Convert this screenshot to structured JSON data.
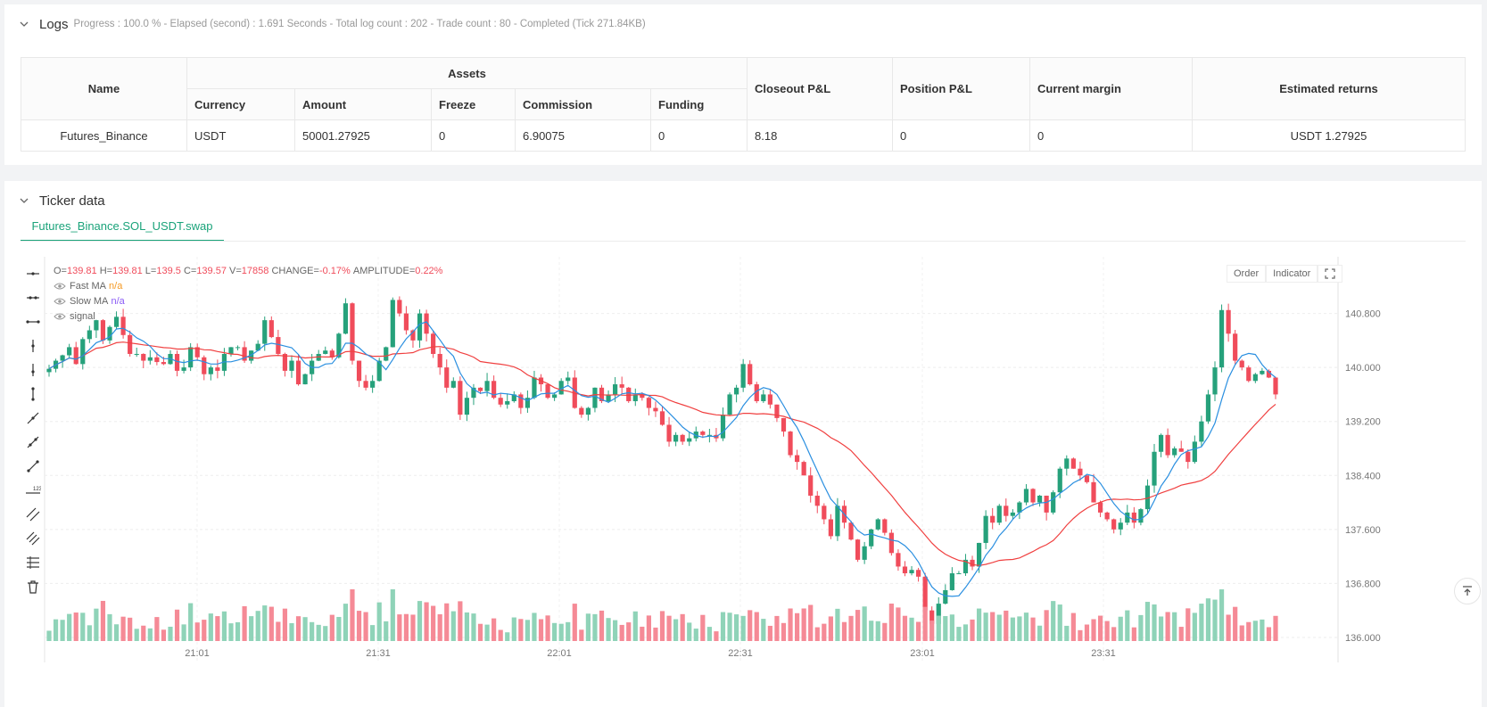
{
  "logs": {
    "title": "Logs",
    "status": "Progress : 100.0 % - Elapsed (second) : 1.691  Seconds - Total log count : 202 - Trade count : 80 - Completed (Tick 271.84KB)"
  },
  "assets_table": {
    "headers": {
      "name": "Name",
      "assets": "Assets",
      "currency": "Currency",
      "amount": "Amount",
      "freeze": "Freeze",
      "commission": "Commission",
      "funding": "Funding",
      "closeout": "Closeout P&L",
      "position": "Position P&L",
      "margin": "Current margin",
      "returns": "Estimated returns"
    },
    "row": {
      "name": "Futures_Binance",
      "currency": "USDT",
      "amount": "50001.27925",
      "freeze": "0",
      "commission": "6.90075",
      "funding": "0",
      "closeout": "8.18",
      "position": "0",
      "margin": "0",
      "returns": "USDT 1.27925"
    }
  },
  "ticker": {
    "title": "Ticker data",
    "tab": "Futures_Binance.SOL_USDT.swap"
  },
  "legend": {
    "ohlc": {
      "o_label": "O=",
      "o": "139.81",
      "h_label": "H=",
      "h": "139.81",
      "l_label": "L=",
      "l": "139.5",
      "c_label": "C=",
      "c": "139.57",
      "v_label": "V=",
      "v": "17858",
      "change_label": "CHANGE=",
      "change": "-0.17%",
      "amp_label": "AMPLITUDE=",
      "amp": "0.22%"
    },
    "fast_ma": {
      "label": "Fast MA",
      "value": "n/a"
    },
    "slow_ma": {
      "label": "Slow MA",
      "value": "n/a"
    },
    "signal": {
      "label": "signal"
    }
  },
  "chart_buttons": {
    "order": "Order",
    "indicator": "Indicator"
  },
  "colors": {
    "up": "#26a17b",
    "down": "#f04c5b",
    "fast_ma": "#2a8fe0",
    "slow_ma": "#f04040",
    "accent": "#1aa37a"
  },
  "chart_data": {
    "type": "candlestick",
    "y_ticks": [
      "140.800",
      "140.000",
      "139.200",
      "138.400",
      "137.600",
      "136.800",
      "136.000"
    ],
    "x_ticks": [
      "21:01",
      "21:31",
      "22:01",
      "22:31",
      "23:01",
      "23:31"
    ],
    "ylim": [
      135.92,
      141.6
    ],
    "close_path": [
      139.98,
      140.1,
      140.18,
      140.3,
      140.05,
      140.42,
      140.55,
      140.7,
      140.4,
      140.6,
      140.75,
      140.48,
      140.2,
      140.2,
      140.1,
      140.15,
      140.08,
      140.05,
      140.2,
      139.95,
      140.0,
      140.3,
      140.15,
      139.9,
      140.0,
      139.95,
      140.2,
      140.3,
      140.3,
      140.1,
      140.25,
      140.35,
      140.7,
      140.45,
      140.2,
      139.95,
      140.1,
      139.75,
      139.9,
      140.1,
      140.2,
      140.25,
      140.15,
      140.5,
      140.95,
      140.1,
      139.8,
      139.7,
      139.8,
      140.1,
      140.3,
      141.0,
      140.8,
      140.55,
      140.4,
      140.8,
      140.5,
      140.2,
      140.0,
      139.7,
      139.8,
      139.3,
      139.55,
      139.7,
      139.65,
      139.8,
      139.55,
      139.45,
      139.5,
      139.6,
      139.4,
      139.55,
      139.85,
      139.75,
      139.55,
      139.6,
      139.8,
      139.85,
      139.4,
      139.3,
      139.4,
      139.7,
      139.5,
      139.6,
      139.75,
      139.7,
      139.5,
      139.6,
      139.55,
      139.4,
      139.35,
      139.15,
      138.9,
      139.0,
      138.9,
      138.95,
      139.05,
      139.0,
      139.0,
      138.95,
      139.3,
      139.6,
      139.7,
      140.05,
      139.75,
      139.5,
      139.6,
      139.45,
      139.25,
      139.05,
      138.7,
      138.6,
      138.4,
      138.1,
      137.95,
      137.75,
      137.5,
      137.95,
      137.7,
      137.45,
      137.15,
      137.35,
      137.6,
      137.75,
      137.55,
      137.25,
      137.05,
      136.95,
      137.0,
      136.9,
      136.4,
      136.2,
      136.5,
      136.7,
      136.95,
      136.95,
      137.15,
      137.05,
      137.4,
      137.8,
      137.7,
      137.95,
      137.8,
      137.85,
      138.0,
      138.2,
      138.0,
      138.1,
      137.85,
      138.15,
      138.5,
      138.65,
      138.5,
      138.4,
      138.3,
      138.0,
      137.85,
      137.75,
      137.6,
      137.7,
      137.85,
      137.7,
      137.9,
      138.25,
      138.75,
      139.0,
      138.7,
      138.8,
      138.75,
      138.6,
      138.9,
      139.2,
      139.6,
      140.0,
      140.85,
      140.5,
      140.1,
      140.0,
      139.8,
      139.9,
      139.95,
      139.85,
      139.6
    ]
  }
}
